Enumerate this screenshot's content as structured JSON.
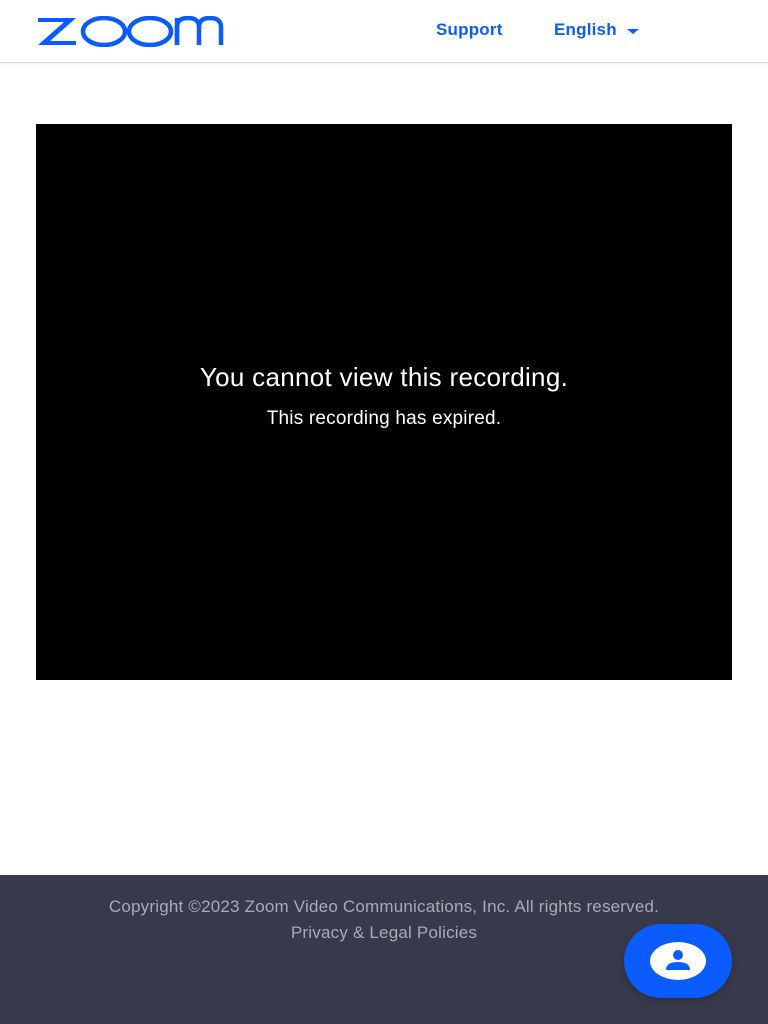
{
  "colors": {
    "brand": "#0b5cff",
    "player_bg": "#000000",
    "footer_bg": "#383a4b",
    "footer_text": "#a9aab6"
  },
  "header": {
    "logo_text": "zoom",
    "logo_icon": "zoom-logo",
    "nav": {
      "support": "Support",
      "language": "English",
      "language_icon": "chevron-down-icon"
    }
  },
  "player": {
    "title": "You cannot view this recording.",
    "subtitle": "This recording has expired."
  },
  "footer": {
    "copyright": "Copyright ©2023 Zoom Video Communications, Inc. All rights reserved.",
    "legal_link": "Privacy & Legal Policies"
  },
  "chat_widget": {
    "icon": "chat-bot-icon"
  }
}
